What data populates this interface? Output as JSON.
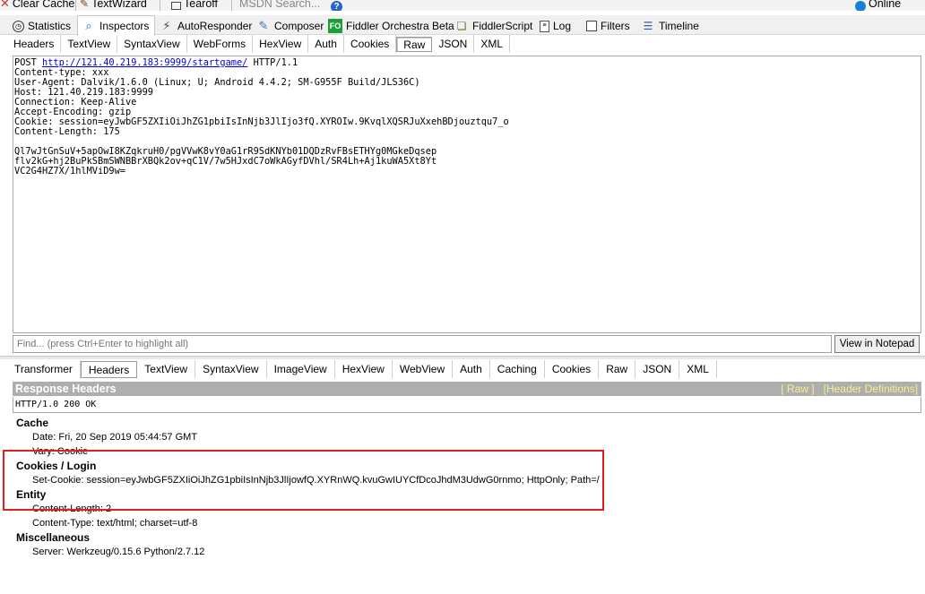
{
  "toolbar": {
    "clear_cache": "Clear Cache",
    "textwizard": "TextWizard",
    "tearoff": "Tearoff",
    "msdn_search": "MSDN Search...",
    "online": "Online"
  },
  "main_tabs": [
    {
      "label": "Statistics",
      "icon": "stopwatch-icon"
    },
    {
      "label": "Inspectors",
      "icon": "inspectors-icon"
    },
    {
      "label": "AutoResponder",
      "icon": "lightning-icon"
    },
    {
      "label": "Composer",
      "icon": "composer-icon"
    },
    {
      "label": "Fiddler Orchestra Beta",
      "icon": "fo-icon",
      "badge": "FO"
    },
    {
      "label": "FiddlerScript",
      "icon": "script-icon"
    },
    {
      "label": "Log",
      "icon": "log-icon"
    },
    {
      "label": "Filters",
      "icon": "checkbox-icon"
    },
    {
      "label": "Timeline",
      "icon": "timeline-icon"
    }
  ],
  "request_tabs": [
    "Headers",
    "TextView",
    "SyntaxView",
    "WebForms",
    "HexView",
    "Auth",
    "Cookies",
    "Raw",
    "JSON",
    "XML"
  ],
  "request": {
    "line1_method": "POST ",
    "line1_url": "http://121.40.219.183:9999/startgame/",
    "line1_version": " HTTP/1.1",
    "body_lines": "Content-type: xxx\nUser-Agent: Dalvik/1.6.0 (Linux; U; Android 4.4.2; SM-G955F Build/JLS36C)\nHost: 121.40.219.183:9999\nConnection: Keep-Alive\nAccept-Encoding: gzip\nCookie: session=eyJwbGF5ZXIiOiJhZG1pbiIsInNjb3JlIjo3fQ.XYROIw.9KvqlXQSRJuXxehBDjouztqu7_o\nContent-Length: 175\n\nQl7wJtGnSuV+5apOwI8KZqkruH0/pgVVwK8vY0aG1rR9SdKNYb01DQDzRvFBsETHYg0MGkeDqsep\nflv2kG+hj2BuPkSBmSWNBBrXBQk2ov+qC1V/7w5HJxdC7oWkAGyfDVhl/SR4Lh+Aj1kuWA5Xt8Yt\nVC2G4HZ7X/1hlMViD9w="
  },
  "find": {
    "placeholder": "Find... (press Ctrl+Enter to highlight all)",
    "notepad_button": "View in Notepad"
  },
  "response_tabs": [
    "Transformer",
    "Headers",
    "TextView",
    "SyntaxView",
    "ImageView",
    "HexView",
    "WebView",
    "Auth",
    "Caching",
    "Cookies",
    "Raw",
    "JSON",
    "XML"
  ],
  "response": {
    "title": "Response Headers",
    "raw_link": "[ Raw ]",
    "defs_link": "[Header Definitions]",
    "status_line": "HTTP/1.0 200 OK",
    "groups": [
      {
        "name": "Cache",
        "items": [
          "Date: Fri, 20 Sep 2019 05:44:57 GMT",
          "Vary: Cookie"
        ]
      },
      {
        "name": "Cookies / Login",
        "items": [
          "Set-Cookie: session=eyJwbGF5ZXIiOiJhZG1pbiIsInNjb3JlIjowfQ.XYRnWQ.kvuGwIUYCfDcoJhdM3UdwG0rnmo; HttpOnly; Path=/"
        ]
      },
      {
        "name": "Entity",
        "items": [
          "Content-Length: 2",
          "Content-Type: text/html; charset=utf-8"
        ]
      },
      {
        "name": "Miscellaneous",
        "items": [
          "Server: Werkzeug/0.15.6 Python/2.7.12"
        ]
      }
    ]
  },
  "colors": {
    "highlight_box": "#e02020",
    "response_bar": "#aeaeae",
    "response_links": "#f6f08a"
  }
}
